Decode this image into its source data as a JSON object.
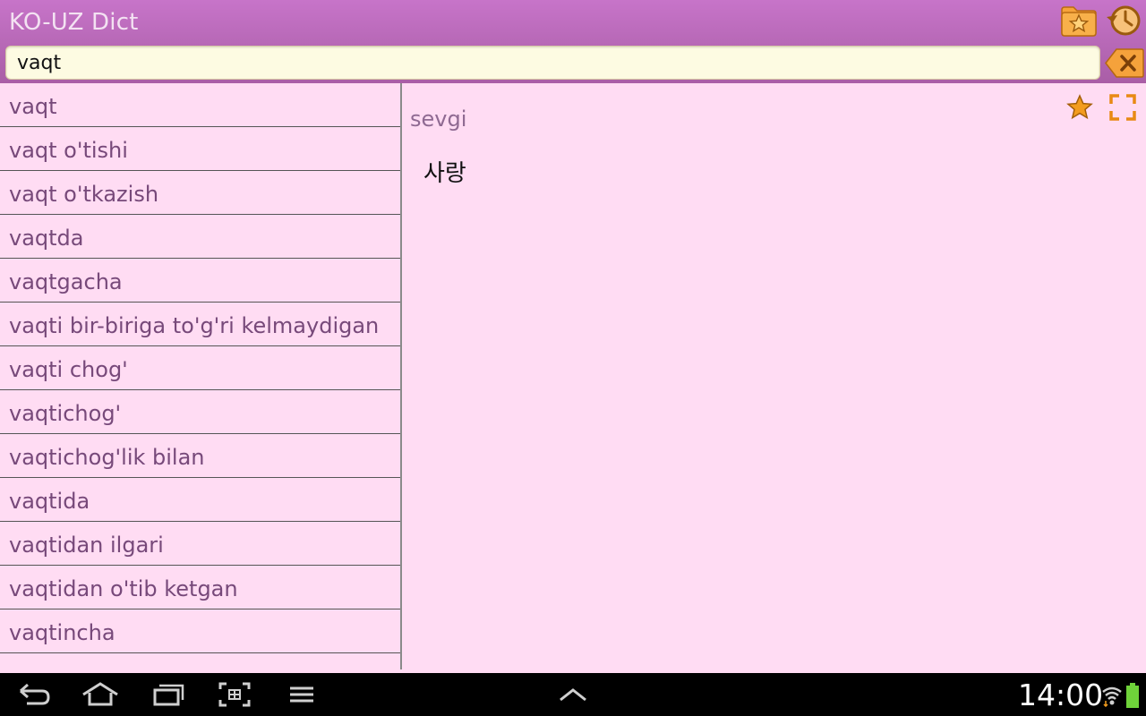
{
  "app": {
    "title": "KO-UZ Dict"
  },
  "search": {
    "value": "vaqt"
  },
  "word_list": [
    "vaqt",
    "vaqt o'tishi",
    "vaqt o'tkazish",
    "vaqtda",
    "vaqtgacha",
    "vaqti bir-biriga to'g'ri kelmaydigan",
    "vaqti chog'",
    "vaqtichog'",
    "vaqtichog'lik bilan",
    "vaqtida",
    "vaqtidan ilgari",
    "vaqtidan o'tib ketgan",
    "vaqtincha"
  ],
  "detail": {
    "word": "sevgi",
    "translation": "사랑"
  },
  "status_bar": {
    "time": "14:00"
  },
  "colors": {
    "header": "#b866b6",
    "list_background": "#ffdcf3",
    "list_text": "#77497a",
    "accent_orange": "#f39c1e"
  },
  "icons": {
    "favorites_folder": "favorites-folder-icon",
    "history": "history-icon",
    "clear": "clear-icon",
    "favorite_star": "star-icon",
    "fullscreen": "fullscreen-icon",
    "nav": [
      "back-icon",
      "home-icon",
      "recent-apps-icon",
      "screenshot-icon",
      "menu-icon",
      "chevron-up-icon",
      "wifi-icon",
      "battery-icon"
    ]
  }
}
